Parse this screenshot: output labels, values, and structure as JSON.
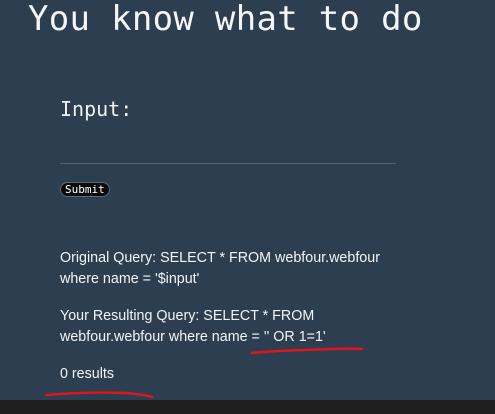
{
  "page": {
    "title": "You know what to do"
  },
  "form": {
    "input_label": "Input:",
    "input_value": "",
    "submit_label": "Submit"
  },
  "results": {
    "original_query": "Original Query: SELECT * FROM webfour.webfour where name = '$input'",
    "resulting_query": "Your Resulting Query: SELECT * FROM webfour.webfour where name = '' OR 1=1'",
    "count_text": "0 results"
  },
  "colors": {
    "background": "#2c3e50",
    "text": "#ffffff",
    "annotation": "#e0141b",
    "button_background": "#0b0b0b"
  }
}
